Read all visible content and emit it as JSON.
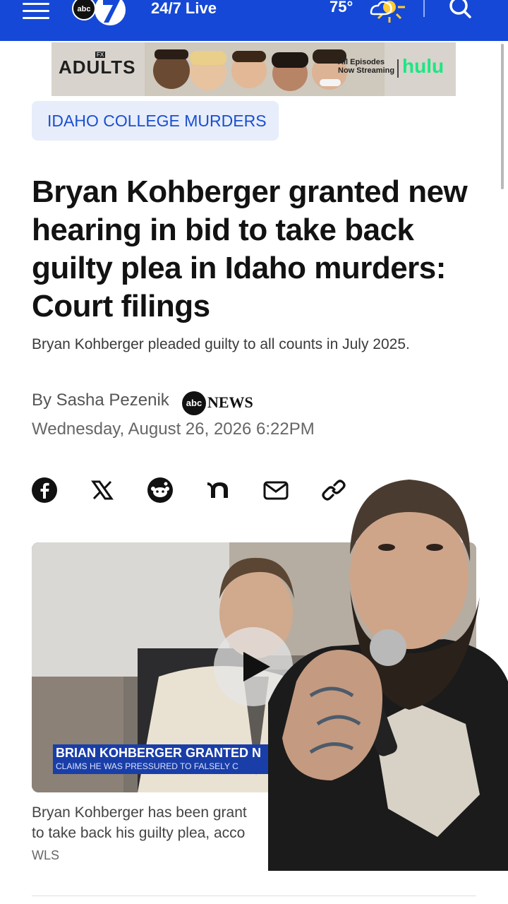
{
  "header": {
    "live_label": "24/7 Live",
    "temperature": "75°",
    "station_logo_text": "abc",
    "icons": [
      "hamburger-menu-icon",
      "partly-sunny-icon",
      "search-icon"
    ]
  },
  "ad": {
    "show_title": "ADULTS",
    "network_badge": "FX",
    "episodes_line1": "All Episodes",
    "episodes_line2": "Now Streaming",
    "brand": "hulu",
    "brand_color": "#1ce783"
  },
  "article": {
    "category_tag": "IDAHO COLLEGE MURDERS",
    "headline": "Bryan Kohberger granted new hearing in bid to take back guilty plea in Idaho murders: Court filings",
    "subheadline": "Bryan Kohberger pleaded guilty to all counts in July 2025.",
    "byline": "By Sasha Pezenik",
    "outlet_circle": "abc",
    "outlet_text": "NEWS",
    "date": "Wednesday, August 26, 2026 6:22PM"
  },
  "share_icons": [
    "facebook-icon",
    "x-icon",
    "reddit-icon",
    "nextdoor-icon",
    "email-icon",
    "copy-link-icon"
  ],
  "video": {
    "lower_third_main": "BRIAN KOHBERGER GRANTED N",
    "lower_third_sub": "CLAIMS HE WAS PRESSURED TO FALSELY C",
    "caption_line1": "Bryan Kohberger has been grant",
    "caption_line2": "to take back his guilty plea, acco",
    "caption_line2_tail": "to",
    "credit": "WLS"
  },
  "colors": {
    "header_blue": "#1548d6",
    "tag_bg": "#e7edfa",
    "tag_text": "#1a4fd1",
    "lower_third": "#1a3ea8"
  }
}
